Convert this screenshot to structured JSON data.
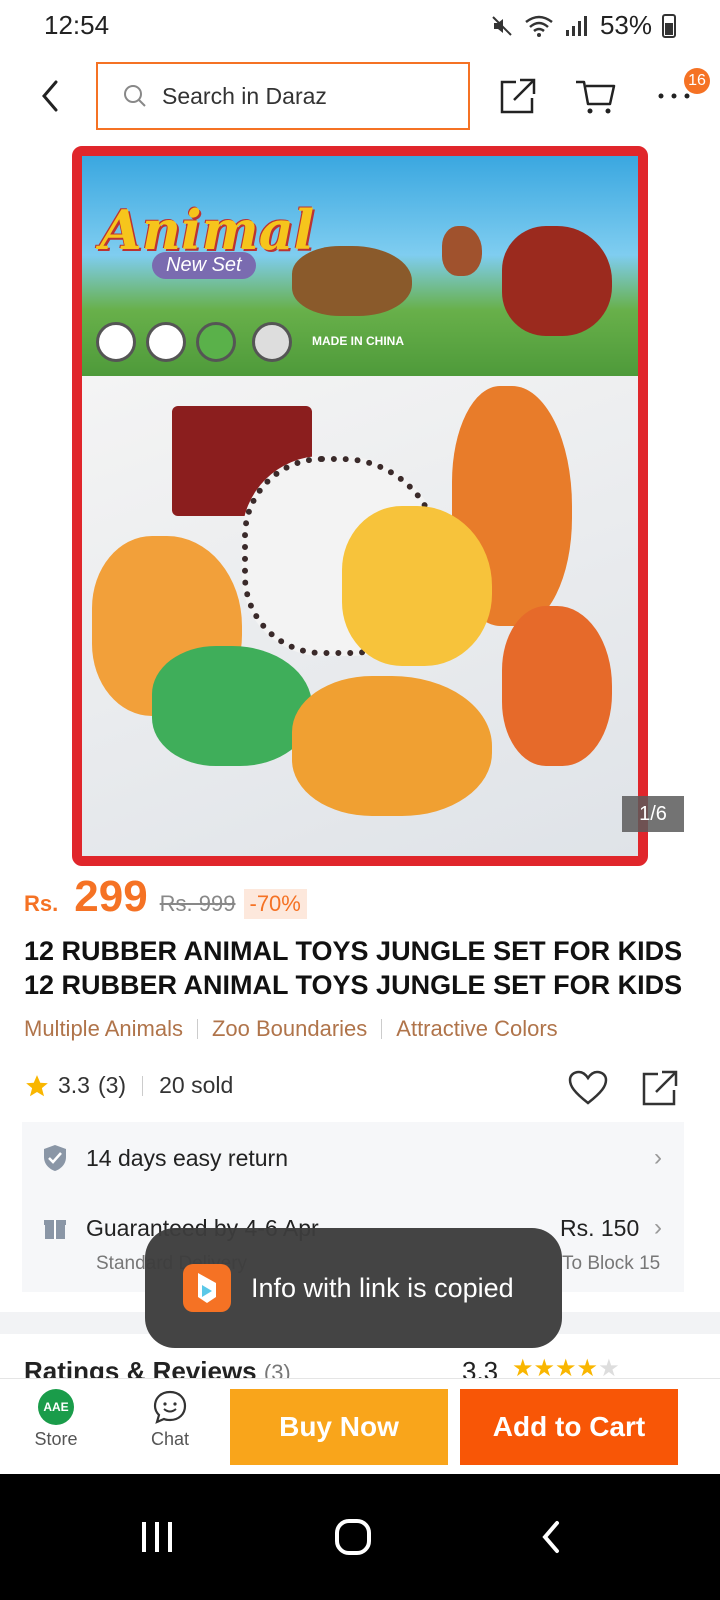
{
  "status_bar": {
    "time": "12:54",
    "battery": "53%"
  },
  "header": {
    "search_placeholder": "Search in Daraz",
    "more_badge": "16"
  },
  "gallery": {
    "package_title": "Animal",
    "package_subtitle": "New Set",
    "package_origin": "MADE IN CHINA",
    "counter": "1/6"
  },
  "price": {
    "currency": "Rs.",
    "current": "299",
    "original": "Rs. 999",
    "discount": "-70%"
  },
  "product": {
    "title_line1": "12 RUBBER ANIMAL TOYS JUNGLE SET FOR KIDS",
    "title_line2": "12 RUBBER ANIMAL TOYS JUNGLE SET FOR KIDS",
    "tags": [
      "Multiple Animals",
      "Zoo Boundaries",
      "Attractive Colors"
    ],
    "rating": "3.3",
    "rating_count": "(3)",
    "sold": "20 sold"
  },
  "services": {
    "return_text": "14 days easy return",
    "delivery_text": "Guaranteed by 4-6 Apr",
    "delivery_type": "Standard Delivery",
    "delivery_price": "Rs. 150",
    "delivery_dest": "To Block 15"
  },
  "reviews": {
    "title": "Ratings & Reviews",
    "count": "(3)",
    "score": "3.3"
  },
  "toast": {
    "text": "Info with link is copied"
  },
  "bottom_bar": {
    "store_label": "Store",
    "store_logo": "AAE",
    "chat_label": "Chat",
    "buy_now": "Buy Now",
    "add_to_cart": "Add to Cart"
  },
  "colors": {
    "accent": "#f57224",
    "buy_now": "#f9a51b",
    "add_to_cart": "#f85606",
    "tag": "#b0744a"
  }
}
